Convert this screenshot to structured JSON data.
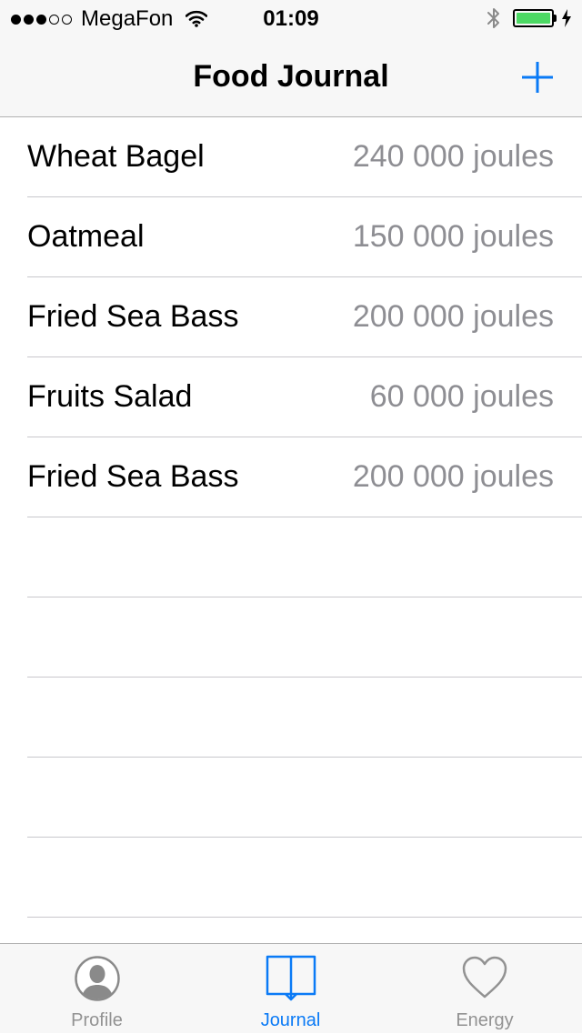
{
  "status_bar": {
    "signal_full": 3,
    "signal_empty": 2,
    "carrier": "MegaFon",
    "time": "01:09",
    "battery_level": 1.0,
    "icons": [
      "wifi-icon",
      "bluetooth-icon",
      "battery-icon",
      "charging-icon"
    ]
  },
  "nav": {
    "title": "Food Journal",
    "add_icon": "plus-icon"
  },
  "entries": [
    {
      "name": "Wheat Bagel",
      "energy": "240 000 joules"
    },
    {
      "name": "Oatmeal",
      "energy": "150 000 joules"
    },
    {
      "name": "Fried Sea Bass",
      "energy": "200 000 joules"
    },
    {
      "name": "Fruits Salad",
      "energy": "60 000 joules"
    },
    {
      "name": "Fried Sea Bass",
      "energy": "200 000 joules"
    }
  ],
  "empty_rows": 5,
  "tabs": [
    {
      "label": "Profile",
      "icon": "profile-icon",
      "active": false
    },
    {
      "label": "Journal",
      "icon": "book-icon",
      "active": true
    },
    {
      "label": "Energy",
      "icon": "heart-icon",
      "active": false
    }
  ],
  "colors": {
    "accent": "#0a7af6",
    "secondary_text": "#8e8e93",
    "inactive_tab": "#929292",
    "battery": "#4cd964",
    "separator": "#c8c7cc",
    "bar_background": "#f7f7f7"
  }
}
